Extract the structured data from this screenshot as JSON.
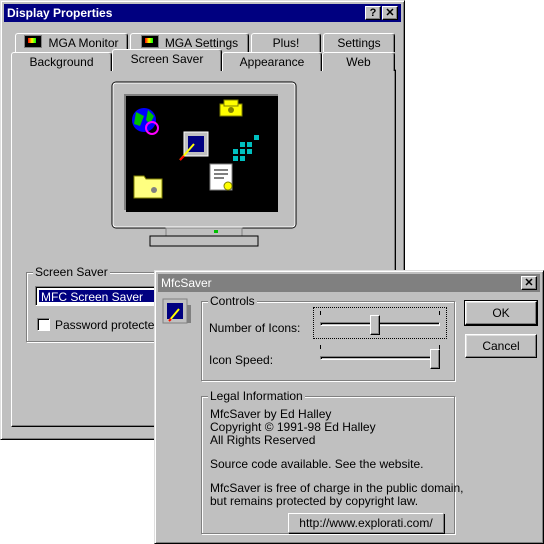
{
  "display_properties": {
    "title": "Display Properties",
    "help_glyph": "?",
    "close_glyph": "✕",
    "tabs_back": [
      {
        "label": "MGA Monitor",
        "icon": "mga-icon"
      },
      {
        "label": "MGA Settings",
        "icon": "mga-icon"
      },
      {
        "label": "Plus!"
      },
      {
        "label": "Settings"
      }
    ],
    "tabs_front": [
      {
        "label": "Background"
      },
      {
        "label": "Screen Saver",
        "active": true
      },
      {
        "label": "Appearance"
      },
      {
        "label": "Web"
      }
    ],
    "screen_saver_group": "Screen Saver",
    "screen_saver_value": "MFC Screen Saver",
    "password_label": "Password protected",
    "password_checked": false
  },
  "mfcsaver": {
    "title": "MfcSaver",
    "close_glyph": "✕",
    "controls_group": "Controls",
    "number_of_icons_label": "Number of Icons:",
    "number_of_icons_value": 0.45,
    "icon_speed_label": "Icon Speed:",
    "icon_speed_value": 1.0,
    "ok_label": "OK",
    "cancel_label": "Cancel",
    "legal_group": "Legal Information",
    "legal_lines": [
      "MfcSaver by Ed Halley",
      "Copyright © 1991-98 Ed Halley",
      "All Rights Reserved"
    ],
    "source_line": "Source code available.  See the website.",
    "free_lines": [
      "MfcSaver is free of charge in the public domain,",
      "but remains protected by copyright law."
    ],
    "website": "http://www.explorati.com/"
  },
  "colors": {
    "title_active": "#000080",
    "title_inactive": "#808080",
    "face": "#c0c0c0",
    "monitor_screen": "#000000"
  }
}
